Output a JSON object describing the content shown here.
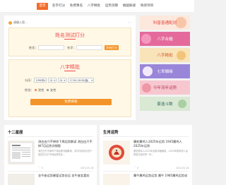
{
  "nav": {
    "items": [
      {
        "label": "首页",
        "active": true
      },
      {
        "label": "名字打分",
        "active": false
      },
      {
        "label": "免费算名",
        "active": false
      },
      {
        "label": "八字精批",
        "active": false
      },
      {
        "label": "运势测算",
        "active": false
      },
      {
        "label": "婚姻解惑",
        "active": false
      },
      {
        "label": "情感项目",
        "active": false
      }
    ]
  },
  "notice": {
    "text": "请输入您..."
  },
  "name_test": {
    "title": "姓名测试打分",
    "surname_label": "姓氏：",
    "given_label": "名字：",
    "button": "开始打分"
  },
  "bazi": {
    "title": "八字精批",
    "birth_label": "公历：",
    "year": "1990年",
    "month": "01",
    "day": "01",
    "hour": "17:00-18:59(酉)",
    "gender_label": "性别：",
    "male": "男性",
    "female": "女性",
    "gender_selected": "male",
    "button": "免费揭秘"
  },
  "banners": [
    {
      "label": "科普普通配对",
      "color": "#e0463c",
      "bg": "#fde8dd"
    },
    {
      "label": "八字合婚",
      "color": "#ffffff",
      "bg": "#e46a9c"
    },
    {
      "label": "八字精批",
      "color": "#d2592a",
      "bg": "#f9e3b8"
    },
    {
      "label": "七世姻缘",
      "color": "#ffffff",
      "bg": "#9a86d9"
    },
    {
      "label": "今年流年运势",
      "color": "#b43a57",
      "bg": "#f7c7cf"
    },
    {
      "label": "姜逢斗数",
      "color": "#3a6e6a",
      "bg": "#d9e9d4"
    }
  ],
  "zodiac_section": {
    "title": "十二星座",
    "articles": [
      {
        "title": "测白白只不掉你下周运势解读 测白白只不掉7月运势详细版",
        "desc": "测白白只不掉你下周运势详细解读，本次内容将为您介绍测白白只不掉运势变化...",
        "date": "2024-05-28",
        "meta": "0"
      },
      {
        "title": "金牛座运势最爱运势金运 金牛座女喜欢",
        "desc": "",
        "date": "",
        "meta": ""
      }
    ]
  },
  "zodiac_animal_section": {
    "title": "生肖运势",
    "articles": [
      {
        "title": "属蛇属鸡人2025年运势 1945属鸡人2025年运势",
        "desc": "属蛇属鸡人2025年运势详细解读，2025年属鸡的人运势是比较好的一年...",
        "date": "2024-05-28",
        "meta": "0"
      },
      {
        "title": "属牛属鸡运势运势 属牛 1985属鸡运势说",
        "desc": "",
        "date": "",
        "meta": ""
      }
    ]
  }
}
